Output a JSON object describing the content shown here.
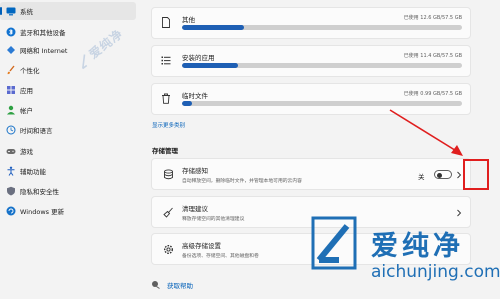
{
  "sidebar": {
    "items": [
      {
        "label": "系统",
        "icon": "monitor-icon",
        "selected": true
      },
      {
        "label": "蓝牙和其他设备",
        "icon": "bluetooth-icon"
      },
      {
        "label": "网络和 Internet",
        "icon": "wifi-diamond-icon"
      },
      {
        "label": "个性化",
        "icon": "brush-icon"
      },
      {
        "label": "应用",
        "icon": "apps-grid-icon"
      },
      {
        "label": "帐户",
        "icon": "person-icon"
      },
      {
        "label": "时间和语言",
        "icon": "globe-clock-icon"
      },
      {
        "label": "游戏",
        "icon": "gamepad-icon"
      },
      {
        "label": "辅助功能",
        "icon": "accessibility-icon"
      },
      {
        "label": "隐私和安全性",
        "icon": "shield-icon"
      },
      {
        "label": "Windows 更新",
        "icon": "update-icon"
      }
    ]
  },
  "watermark_small": {
    "text": "爱纯净"
  },
  "storage": [
    {
      "name": "其他",
      "used": "已使用 12.6 GB/57.5 GB",
      "fill_fraction": 0.22,
      "icon": "document-icon"
    },
    {
      "name": "安装的应用",
      "used": "已使用 11.4 GB/57.5 GB",
      "fill_fraction": 0.2,
      "icon": "list-icon"
    },
    {
      "name": "临时文件",
      "used": "已使用 0.99 GB/57.5 GB",
      "fill_fraction": 0.035,
      "icon": "trash-icon"
    }
  ],
  "show_more": "显示更多类别",
  "management": {
    "title": "存储管理",
    "items": [
      {
        "title": "存储感知",
        "desc": "自动释放空间，删除临时文件，并管理本地可用的云内容",
        "toggle_label": "关",
        "icon": "storage-drive-icon"
      },
      {
        "title": "清理建议",
        "desc": "释放存储空间的其他清理建议",
        "icon": "broom-icon"
      },
      {
        "title": "高级存储设置",
        "desc": "备份选项、存储空间、其他磁盘和卷",
        "icon": "gear-icon"
      }
    ]
  },
  "help": {
    "label": "获取帮助"
  },
  "watermark": {
    "cn": "爱纯净",
    "url": "aichunjing.com"
  },
  "colors": {
    "accent": "#005fb8",
    "bar_fill": "#1e5fb4",
    "annotation": "#e01e1e",
    "watermark": "#1f6fb5"
  }
}
